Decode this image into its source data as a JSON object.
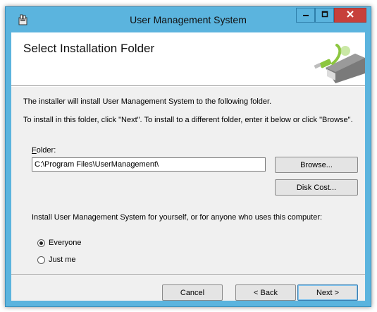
{
  "window": {
    "title": "User Management System",
    "icon": "installer-icon"
  },
  "titlebar": {
    "minimize_icon": "minimize-icon",
    "maximize_icon": "maximize-icon",
    "close_icon": "close-icon"
  },
  "banner": {
    "heading": "Select Installation Folder",
    "image": "installer-banner-graphic"
  },
  "body": {
    "line1": "The installer will install User Management System to the following folder.",
    "line2": "To install in this folder, click \"Next\". To install to a different folder, enter it below or click \"Browse\".",
    "folder_label_accel": "F",
    "folder_label_rest": "older:",
    "folder_value": "C:\\Program Files\\UserManagement\\",
    "browse_label": "Browse...",
    "disk_cost_label": "Disk Cost...",
    "install_for_label": "Install User Management System for yourself, or for anyone who uses this computer:",
    "options": [
      {
        "label": "Everyone",
        "checked": true
      },
      {
        "label": "Just me",
        "checked": false
      }
    ]
  },
  "footer": {
    "cancel_label": "Cancel",
    "back_label": "< Back",
    "next_label": "Next >"
  },
  "colors": {
    "titlebar": "#5bb4de",
    "close_button": "#c7403b",
    "client_background": "#f0f0f0"
  }
}
